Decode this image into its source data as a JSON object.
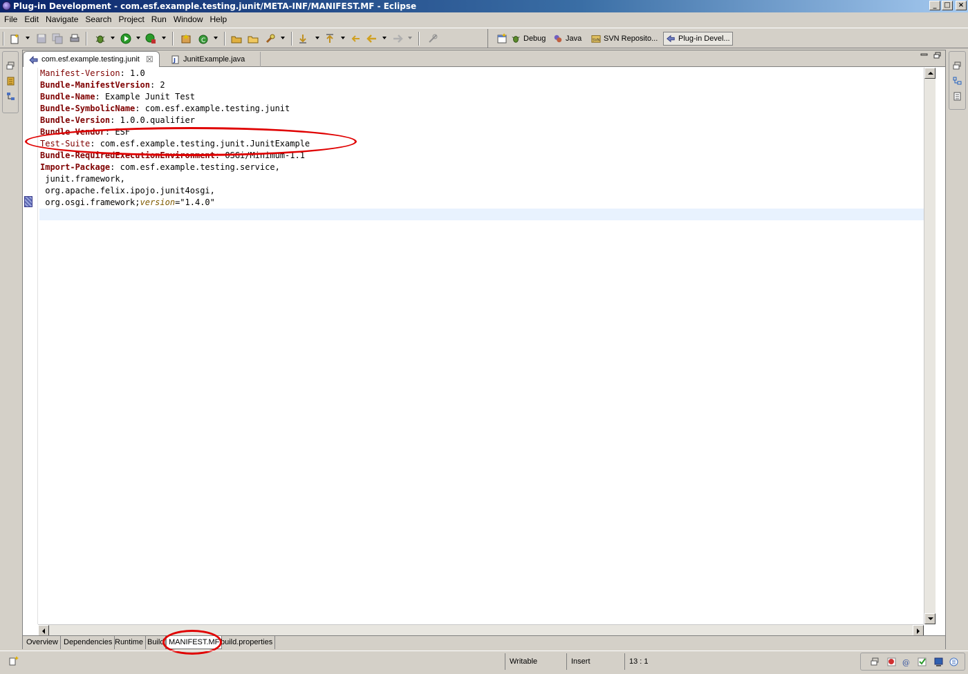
{
  "window": {
    "title": "Plug-in Development - com.esf.example.testing.junit/META-INF/MANIFEST.MF - Eclipse",
    "minimize": "_",
    "maximize": "□",
    "close": "×"
  },
  "menubar": [
    "File",
    "Edit",
    "Navigate",
    "Search",
    "Project",
    "Run",
    "Window",
    "Help"
  ],
  "perspectives": [
    {
      "label": "Debug"
    },
    {
      "label": "Java"
    },
    {
      "label": "SVN Reposito..."
    },
    {
      "label": "Plug-in Devel..."
    }
  ],
  "editor": {
    "tabs": [
      {
        "label": "com.esf.example.testing.junit",
        "close": "☒"
      },
      {
        "label": "JunitExample.java"
      }
    ],
    "lines": [
      {
        "key": "Manifest-Version",
        "sep": ":",
        "value": " 1.0"
      },
      {
        "key": "Bundle-ManifestVersion",
        "sep": ":",
        "value": " 2"
      },
      {
        "key": "Bundle-Name",
        "sep": ":",
        "value": " Example Junit Test"
      },
      {
        "key": "Bundle-SymbolicName",
        "sep": ":",
        "value": " com.esf.example.testing.junit"
      },
      {
        "key": "Bundle-Version",
        "sep": ":",
        "value": " 1.0.0.qualifier"
      },
      {
        "key": "Bundle-Vendor",
        "sep": ":",
        "value": " ESF"
      },
      {
        "key": "Test-Suite",
        "sep": ":",
        "value": " com.esf.example.testing.junit.JunitExample"
      },
      {
        "key": "Bundle-RequiredExecutionEnvironment",
        "sep": ":",
        "value": " OSGi/Minimum-1.1"
      },
      {
        "key": "Import-Package",
        "sep": ":",
        "value": " com.esf.example.testing.service,"
      },
      {
        "value": " junit.framework,"
      },
      {
        "value": " org.apache.felix.ipojo.junit4osgi,"
      },
      {
        "value": " org.osgi.framework;",
        "attr": "version",
        "attrval": "=\"1.4.0\""
      },
      {
        "value": ""
      }
    ],
    "page_tabs": [
      "Overview",
      "Dependencies",
      "Runtime",
      "Build",
      "MANIFEST.MF",
      "build.properties"
    ]
  },
  "status": {
    "writable": "Writable",
    "insert_mode": "Insert",
    "position": "13 : 1"
  },
  "colors": {
    "keyword": "#7f0000",
    "annotation": "#e00000",
    "title_gradient_start": "#0a246a"
  }
}
